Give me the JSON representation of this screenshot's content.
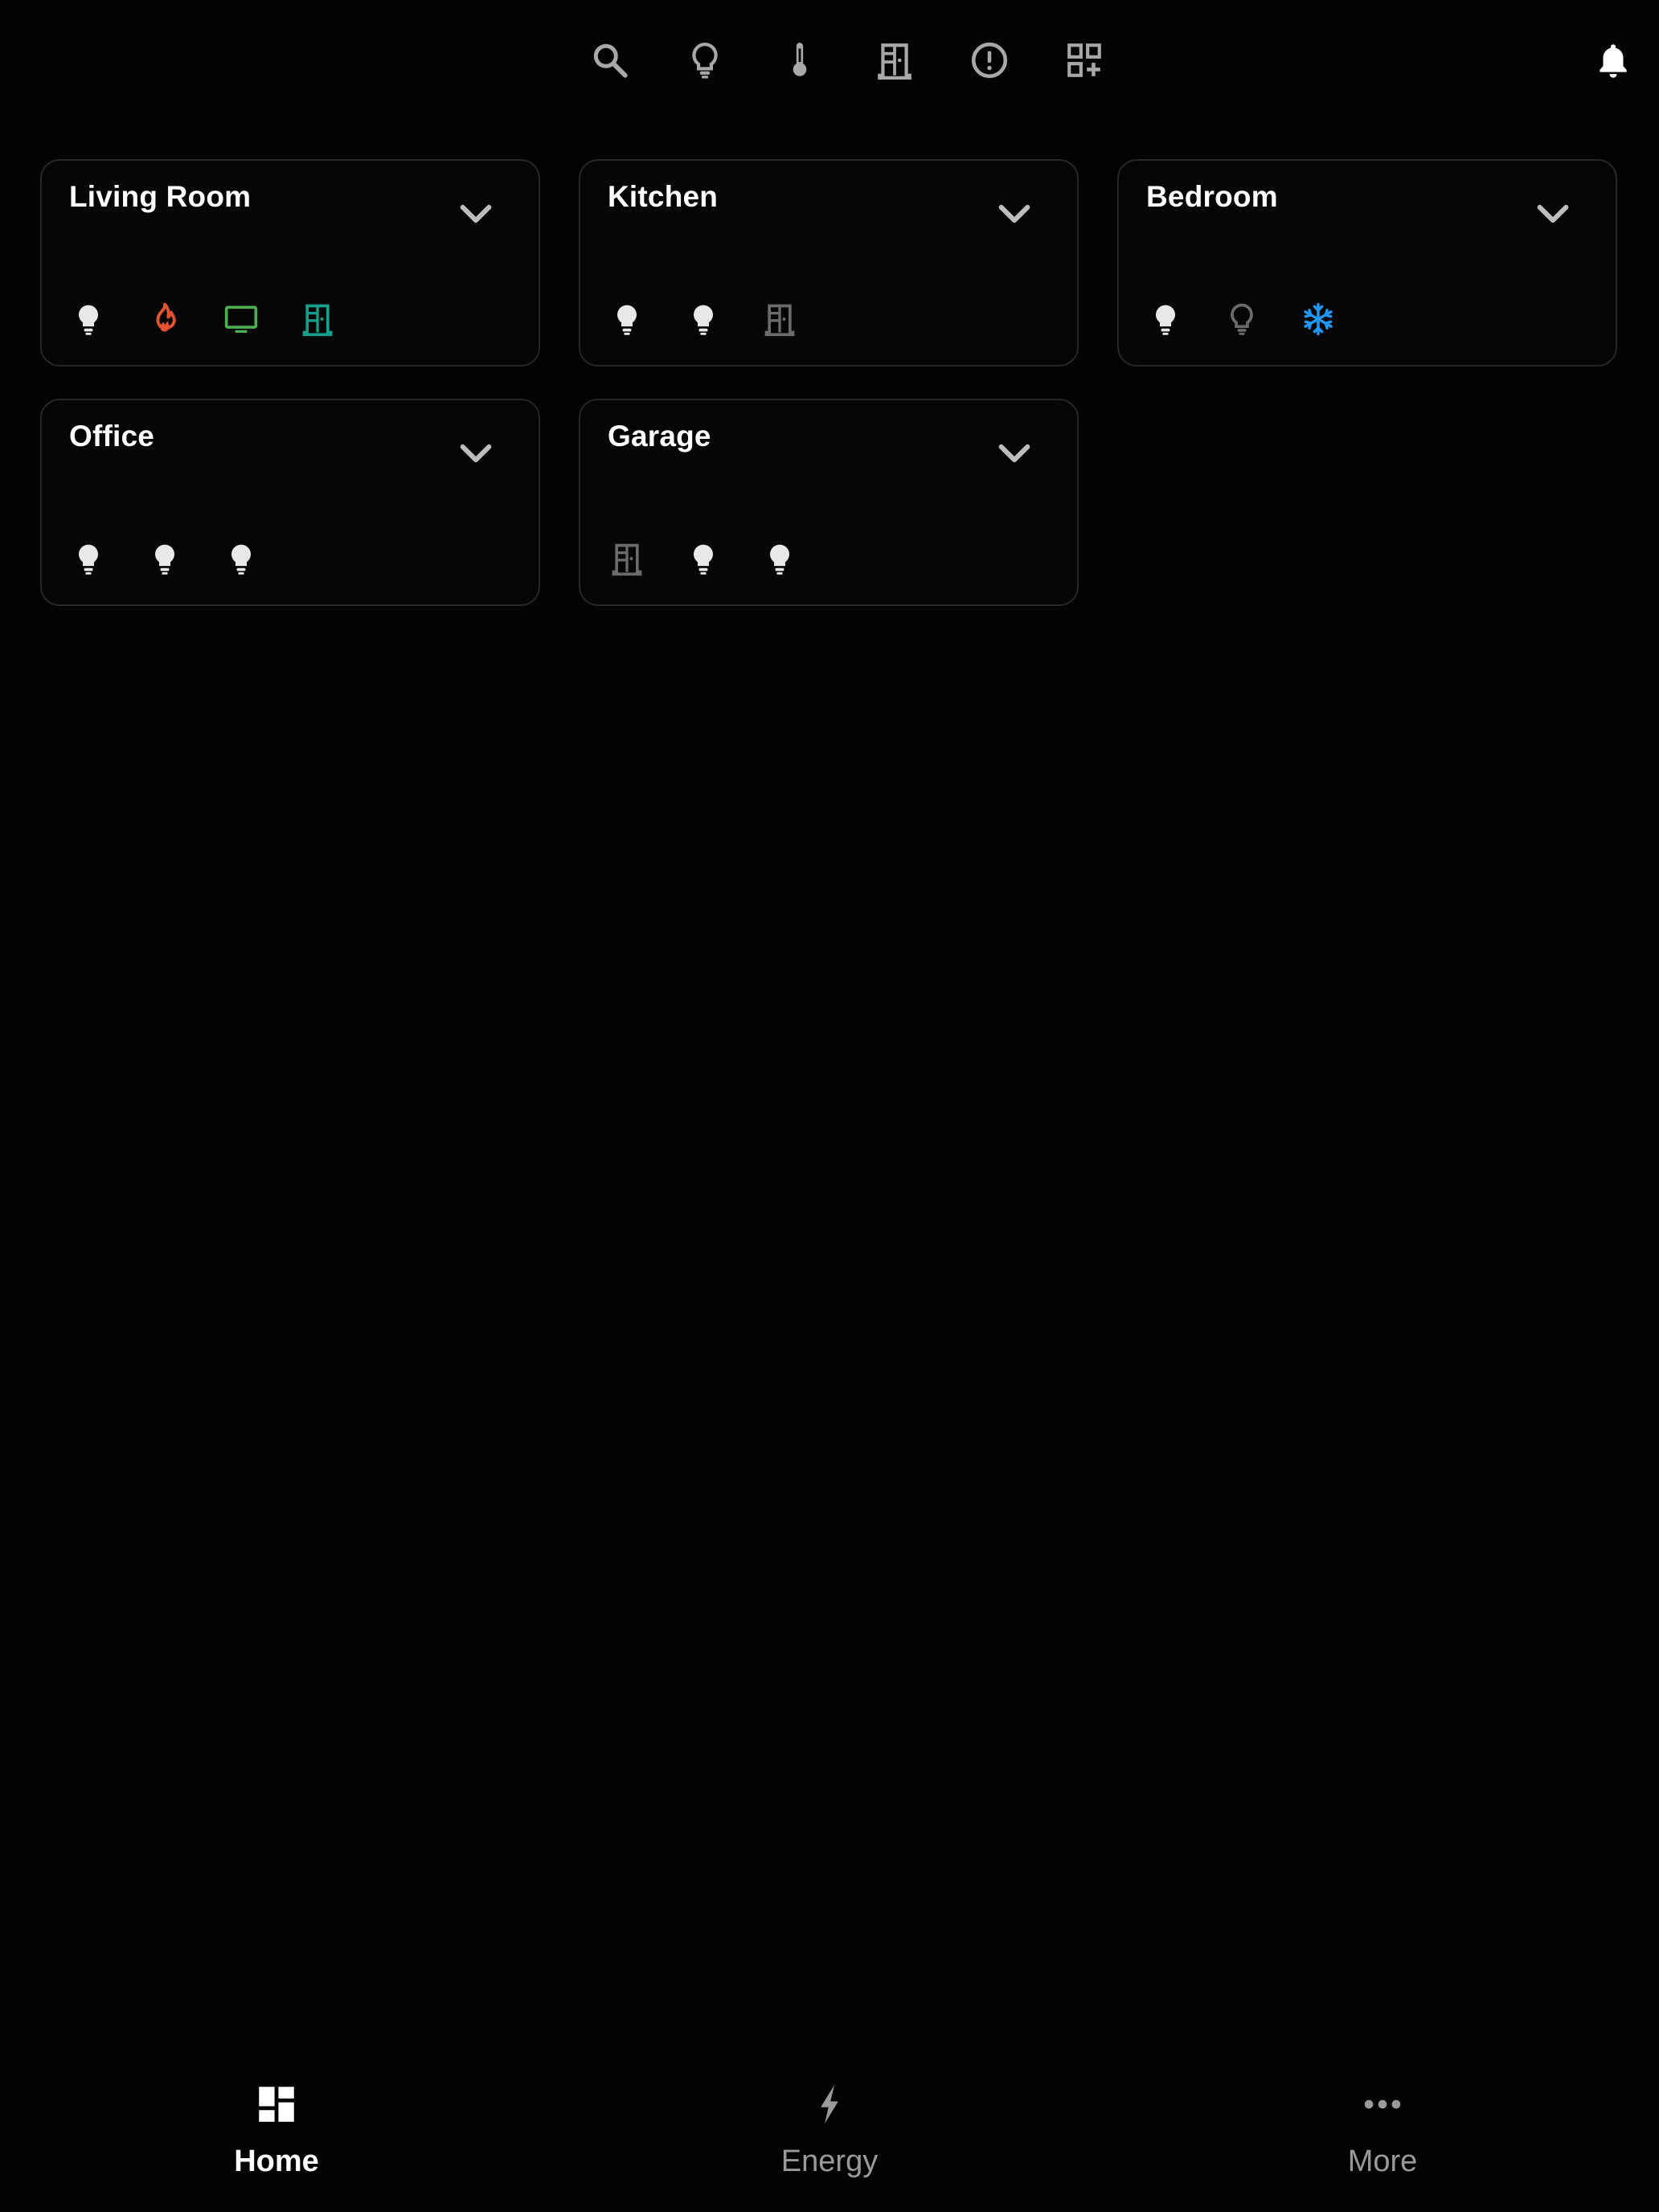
{
  "colors": {
    "background": "#030303",
    "card_border": "#262626",
    "icon_on": "#e8e8e8",
    "icon_dim": "#6b6b6b",
    "icon_top": "#a8a8a8",
    "fire": "#e4532f",
    "tv": "#4caf50",
    "door_teal": "#14a08a",
    "snow": "#2196f3"
  },
  "topbar": {
    "icons": [
      "search-icon",
      "lightbulb-outline-icon",
      "thermometer-icon",
      "door-icon",
      "alert-circle-icon",
      "add-widget-icon"
    ],
    "notification_icon": "bell-icon"
  },
  "areas": [
    {
      "name": "Living Room",
      "entities": [
        {
          "icon": "lightbulb-icon",
          "state": "on"
        },
        {
          "icon": "fire-icon",
          "state": "on"
        },
        {
          "icon": "tv-icon",
          "state": "on"
        },
        {
          "icon": "door-icon",
          "state": "open"
        }
      ]
    },
    {
      "name": "Kitchen",
      "entities": [
        {
          "icon": "lightbulb-icon",
          "state": "on"
        },
        {
          "icon": "lightbulb-icon",
          "state": "on"
        },
        {
          "icon": "door-icon",
          "state": "closed"
        }
      ]
    },
    {
      "name": "Bedroom",
      "entities": [
        {
          "icon": "lightbulb-icon",
          "state": "on"
        },
        {
          "icon": "lightbulb-outline-icon",
          "state": "off"
        },
        {
          "icon": "snowflake-icon",
          "state": "on"
        }
      ]
    },
    {
      "name": "Office",
      "entities": [
        {
          "icon": "lightbulb-icon",
          "state": "on"
        },
        {
          "icon": "lightbulb-icon",
          "state": "on"
        },
        {
          "icon": "lightbulb-icon",
          "state": "on"
        }
      ]
    },
    {
      "name": "Garage",
      "entities": [
        {
          "icon": "door-icon",
          "state": "closed"
        },
        {
          "icon": "lightbulb-icon",
          "state": "on"
        },
        {
          "icon": "lightbulb-icon",
          "state": "on"
        }
      ]
    }
  ],
  "nav": {
    "items": [
      {
        "label": "Home",
        "icon": "dashboard-icon",
        "active": true
      },
      {
        "label": "Energy",
        "icon": "lightning-icon",
        "active": false
      },
      {
        "label": "More",
        "icon": "more-dots-icon",
        "active": false
      }
    ]
  }
}
